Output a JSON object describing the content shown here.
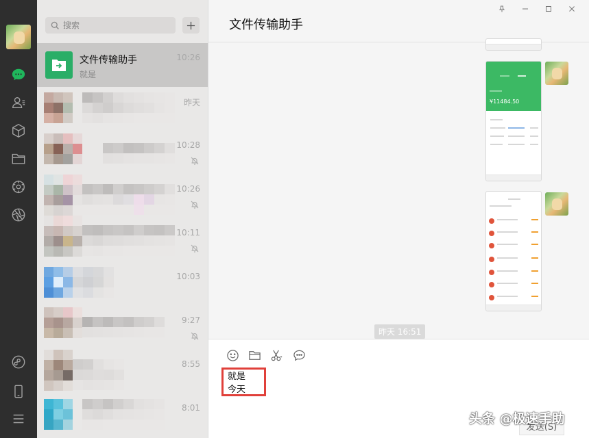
{
  "search": {
    "placeholder": "搜索"
  },
  "header": {
    "title": "文件传输助手"
  },
  "chats": [
    {
      "name": "文件传输助手",
      "preview": "就是",
      "time": "10:26"
    },
    {
      "time": "昨天"
    },
    {
      "time": "10:28"
    },
    {
      "time": "10:26"
    },
    {
      "time": "10:11"
    },
    {
      "time": "10:03"
    },
    {
      "time": "9:27"
    },
    {
      "time": "8:55"
    },
    {
      "time": "8:01"
    }
  ],
  "conversation": {
    "timestamp": "昨天 16:51",
    "screenshot1_balance": "¥11484.50"
  },
  "input": {
    "draft_lines": [
      "就是",
      "今天"
    ],
    "send_label": "发送(S)"
  },
  "watermark": "头条 @极速手助",
  "colors": {
    "accent": "#2aae67",
    "sidebar": "#2e2e2e",
    "highlight": "#e0403a"
  },
  "icons": [
    "chat-icon",
    "contacts-icon",
    "cube-icon",
    "folder-icon",
    "moments-icon",
    "aperture-icon",
    "mini-program-icon",
    "phone-icon",
    "menu-icon"
  ]
}
